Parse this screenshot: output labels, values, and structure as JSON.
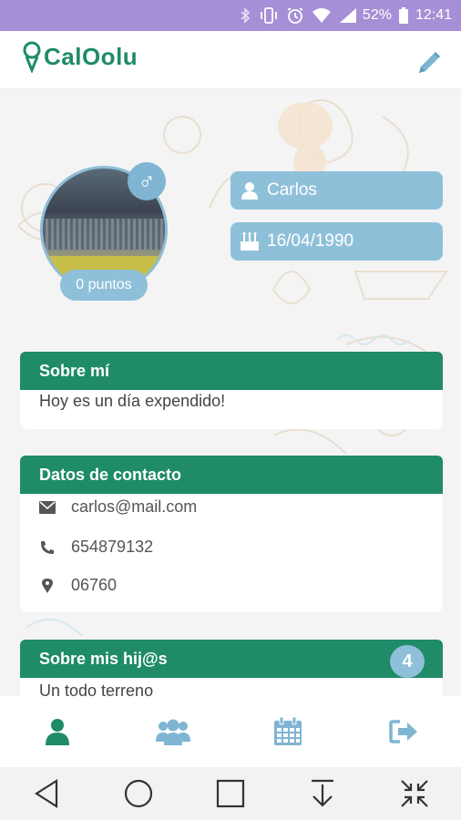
{
  "status_bar": {
    "battery": "52%",
    "time": "12:41",
    "icons": [
      "bluetooth-icon",
      "vibrate-icon",
      "alarm-icon",
      "wifi-icon",
      "signal-icon",
      "battery-icon"
    ]
  },
  "header": {
    "app_name": "CalOolu",
    "edit_icon": "pencil-icon",
    "brand_color": "#1f8b68"
  },
  "profile": {
    "gender_symbol": "♂",
    "points": "0 puntos",
    "name": "Carlos",
    "birthdate": "16/04/1990"
  },
  "about": {
    "title": "Sobre mí",
    "text": "Hoy es un día expendido!"
  },
  "contact": {
    "title": "Datos de contacto",
    "email": "carlos@mail.com",
    "phone": "654879132",
    "zip": "06760"
  },
  "kids": {
    "title": "Sobre mis hij@s",
    "count": "4",
    "text": "Un todo terreno"
  },
  "bottom_nav": {
    "items": [
      "profile-icon",
      "group-icon",
      "calendar-icon",
      "logout-icon"
    ],
    "active": "profile-icon"
  },
  "system_nav": [
    "back-icon",
    "home-icon",
    "recents-icon",
    "download-icon",
    "collapse-icon"
  ],
  "colors": {
    "status_bar": "#a58fd6",
    "accent_green": "#1f8b68",
    "pill_blue": "#8fc0da"
  }
}
